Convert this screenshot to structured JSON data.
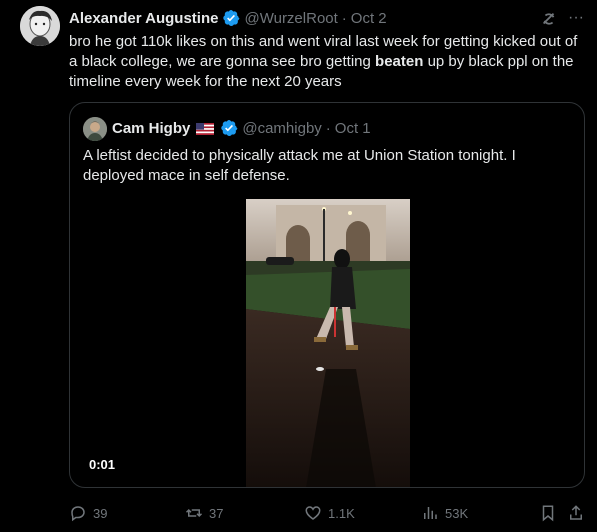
{
  "tweet": {
    "author_name": "Alexander Augustine",
    "handle": "@WurzelRoot",
    "separator": "·",
    "date": "Oct 2",
    "text_before_bold": "bro he got 110k likes on this and went viral last week for getting kicked out of a black college, we are gonna see bro getting ",
    "text_bold": "beaten",
    "text_after_bold": " up by black ppl on the timeline every week for the next 20 years",
    "more_glyph": "···"
  },
  "quote": {
    "author_name": "Cam Higby",
    "handle": "@camhigby",
    "separator": "·",
    "date": "Oct 1",
    "text": "A leftist decided to physically attack me at Union Station tonight. I deployed mace in self defense.",
    "video_timestamp": "0:01"
  },
  "actions": {
    "replies": "39",
    "reposts": "37",
    "likes": "1.1K",
    "views": "53K"
  },
  "colors": {
    "background": "#000000",
    "text": "#e7e9ea",
    "muted": "#71767b",
    "verified": "#1d9bf0",
    "border": "#2f3336"
  }
}
